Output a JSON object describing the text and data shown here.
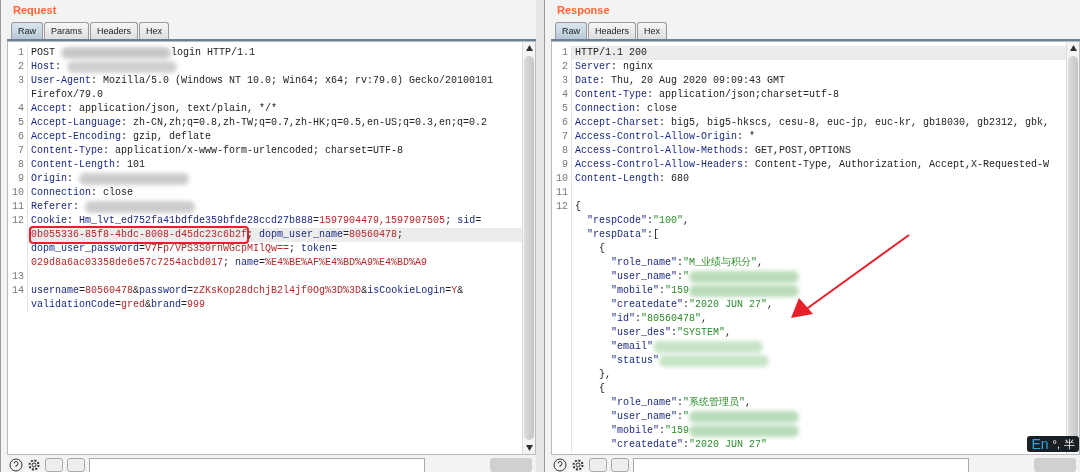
{
  "request": {
    "title": "Request",
    "tabs": [
      {
        "label": "Raw",
        "selected": true
      },
      {
        "label": "Params",
        "selected": false
      },
      {
        "label": "Headers",
        "selected": false
      },
      {
        "label": "Hex",
        "selected": false
      }
    ],
    "lines": [
      {
        "num": "1",
        "selected": false,
        "segments": [
          {
            "kind": "plain",
            "text": "POST "
          },
          {
            "kind": "redacted",
            "color": "#c8c8c8"
          },
          {
            "kind": "plain",
            "text": "login HTTP/1.1"
          }
        ]
      },
      {
        "num": "2",
        "selected": false,
        "segments": [
          {
            "kind": "name",
            "text": "Host"
          },
          {
            "kind": "plain",
            "text": ": "
          },
          {
            "kind": "redacted",
            "color": "#cfcfcf"
          }
        ]
      },
      {
        "num": "3",
        "selected": false,
        "segments": [
          {
            "kind": "name",
            "text": "User-Agent"
          },
          {
            "kind": "plain",
            "text": ": Mozilla/5.0 (Windows NT 10.0; Win64; x64; rv:79.0) Gecko/20100101"
          }
        ]
      },
      {
        "selected": false,
        "segments": [
          {
            "kind": "plain",
            "text": "Firefox/79.0"
          }
        ]
      },
      {
        "num": "4",
        "selected": false,
        "segments": [
          {
            "kind": "name",
            "text": "Accept"
          },
          {
            "kind": "plain",
            "text": ": application/json, text/plain, */*"
          }
        ]
      },
      {
        "num": "5",
        "selected": false,
        "segments": [
          {
            "kind": "name",
            "text": "Accept-Language"
          },
          {
            "kind": "plain",
            "text": ": zh-CN,zh;q=0.8,zh-TW;q=0.7,zh-HK;q=0.5,en-US;q=0.3,en;q=0.2"
          }
        ]
      },
      {
        "num": "6",
        "selected": false,
        "segments": [
          {
            "kind": "name",
            "text": "Accept-Encoding"
          },
          {
            "kind": "plain",
            "text": ": gzip, deflate"
          }
        ]
      },
      {
        "num": "7",
        "selected": false,
        "segments": [
          {
            "kind": "name",
            "text": "Content-Type"
          },
          {
            "kind": "plain",
            "text": ": application/x-www-form-urlencoded; charset=UTF-8"
          }
        ]
      },
      {
        "num": "8",
        "selected": false,
        "segments": [
          {
            "kind": "name",
            "text": "Content-Length"
          },
          {
            "kind": "plain",
            "text": ": 101"
          }
        ]
      },
      {
        "num": "9",
        "selected": false,
        "segments": [
          {
            "kind": "name",
            "text": "Origin"
          },
          {
            "kind": "plain",
            "text": ": "
          },
          {
            "kind": "redacted",
            "color": "#cccccc"
          }
        ]
      },
      {
        "num": "10",
        "selected": false,
        "segments": [
          {
            "kind": "name",
            "text": "Connection"
          },
          {
            "kind": "plain",
            "text": ": close"
          }
        ]
      },
      {
        "num": "11",
        "selected": false,
        "segments": [
          {
            "kind": "name",
            "text": "Referer"
          },
          {
            "kind": "plain",
            "text": ": "
          },
          {
            "kind": "redacted",
            "color": "#cccccc"
          }
        ]
      },
      {
        "num": "12",
        "selected": false,
        "segments": [
          {
            "kind": "name",
            "text": "Cookie"
          },
          {
            "kind": "plain",
            "text": ": "
          },
          {
            "kind": "name",
            "text": "Hm_lvt_ed752fa41bdfde359bfde28ccd27b888"
          },
          {
            "kind": "plain",
            "text": "="
          },
          {
            "kind": "value",
            "text": "1597904479,1597907505"
          },
          {
            "kind": "plain",
            "text": "; "
          },
          {
            "kind": "name",
            "text": "sid"
          },
          {
            "kind": "plain",
            "text": "="
          }
        ]
      },
      {
        "selected": true,
        "segments": [
          {
            "kind": "value",
            "text": "0b055336-85f8-4bdc-8008-d45dc23c6b2f",
            "highlighted": true
          },
          {
            "kind": "plain",
            "text": "; "
          },
          {
            "kind": "name",
            "text": "dopm_user_name"
          },
          {
            "kind": "plain",
            "text": "="
          },
          {
            "kind": "value",
            "text": "80560478"
          },
          {
            "kind": "plain",
            "text": ";"
          }
        ]
      },
      {
        "selected": false,
        "segments": [
          {
            "kind": "name",
            "text": "dopm_user_password"
          },
          {
            "kind": "plain",
            "text": "="
          },
          {
            "kind": "value",
            "text": "V7Fp/VPS3S0rnWGcpMIlQw=="
          },
          {
            "kind": "plain",
            "text": "; "
          },
          {
            "kind": "name",
            "text": "token"
          },
          {
            "kind": "plain",
            "text": "="
          }
        ]
      },
      {
        "selected": false,
        "segments": [
          {
            "kind": "value",
            "text": "029d8a6ac03358de6e57c7254acbd017"
          },
          {
            "kind": "plain",
            "text": "; "
          },
          {
            "kind": "name",
            "text": "name"
          },
          {
            "kind": "plain",
            "text": "="
          },
          {
            "kind": "value",
            "text": "%E4%BE%AF%E4%BD%A9%E4%BD%A9"
          }
        ]
      },
      {
        "num": "13",
        "selected": false
      },
      {
        "num": "14",
        "selected": false,
        "segments": [
          {
            "kind": "name",
            "text": "username"
          },
          {
            "kind": "plain",
            "text": "="
          },
          {
            "kind": "value",
            "text": "80560478"
          },
          {
            "kind": "plain",
            "text": "&"
          },
          {
            "kind": "name",
            "text": "password"
          },
          {
            "kind": "plain",
            "text": "="
          },
          {
            "kind": "value",
            "text": "zZKsKop28dchjB2l4jf0Og%3D%3D"
          },
          {
            "kind": "plain",
            "text": "&"
          },
          {
            "kind": "name",
            "text": "isCookieLogin"
          },
          {
            "kind": "plain",
            "text": "="
          },
          {
            "kind": "value",
            "text": "Y"
          },
          {
            "kind": "plain",
            "text": "&"
          }
        ]
      },
      {
        "selected": false,
        "segments": [
          {
            "kind": "name",
            "text": "validationCode"
          },
          {
            "kind": "plain",
            "text": "="
          },
          {
            "kind": "value",
            "text": "gred"
          },
          {
            "kind": "plain",
            "text": "&"
          },
          {
            "kind": "name",
            "text": "brand"
          },
          {
            "kind": "plain",
            "text": "="
          },
          {
            "kind": "value",
            "text": "999"
          }
        ]
      }
    ]
  },
  "response": {
    "title": "Response",
    "tabs": [
      {
        "label": "Raw",
        "selected": true
      },
      {
        "label": "Headers",
        "selected": false
      },
      {
        "label": "Hex",
        "selected": false
      }
    ],
    "lines": [
      {
        "num": "1",
        "selected": true,
        "segments": [
          {
            "kind": "plain",
            "text": "HTTP/1.1 200"
          }
        ]
      },
      {
        "num": "2",
        "selected": false,
        "segments": [
          {
            "kind": "name",
            "text": "Server"
          },
          {
            "kind": "plain",
            "text": ": nginx"
          }
        ]
      },
      {
        "num": "3",
        "selected": false,
        "segments": [
          {
            "kind": "name",
            "text": "Date"
          },
          {
            "kind": "plain",
            "text": ": Thu, 20 Aug 2020 09:09:43 GMT"
          }
        ]
      },
      {
        "num": "4",
        "selected": false,
        "segments": [
          {
            "kind": "name",
            "text": "Content-Type"
          },
          {
            "kind": "plain",
            "text": ": application/json;charset=utf-8"
          }
        ]
      },
      {
        "num": "5",
        "selected": false,
        "segments": [
          {
            "kind": "name",
            "text": "Connection"
          },
          {
            "kind": "plain",
            "text": ": close"
          }
        ]
      },
      {
        "num": "6",
        "selected": false,
        "segments": [
          {
            "kind": "name",
            "text": "Accept-Charset"
          },
          {
            "kind": "plain",
            "text": ": big5, big5-hkscs, cesu-8, euc-jp, euc-kr, gb18030, gb2312, gbk,"
          }
        ]
      },
      {
        "num": "7",
        "selected": false,
        "segments": [
          {
            "kind": "name",
            "text": "Access-Control-Allow-Origin"
          },
          {
            "kind": "plain",
            "text": ": *"
          }
        ]
      },
      {
        "num": "8",
        "selected": false,
        "segments": [
          {
            "kind": "name",
            "text": "Access-Control-Allow-Methods"
          },
          {
            "kind": "plain",
            "text": ": GET,POST,OPTIONS"
          }
        ]
      },
      {
        "num": "9",
        "selected": false,
        "segments": [
          {
            "kind": "name",
            "text": "Access-Control-Allow-Headers"
          },
          {
            "kind": "plain",
            "text": ": Content-Type, Authorization, Accept,X-Requested-W"
          }
        ]
      },
      {
        "num": "10",
        "selected": false,
        "segments": [
          {
            "kind": "name",
            "text": "Content-Length"
          },
          {
            "kind": "plain",
            "text": ": 680"
          }
        ]
      },
      {
        "num": "11",
        "selected": false
      },
      {
        "num": "12",
        "selected": false,
        "segments": [
          {
            "kind": "plain",
            "text": "{"
          }
        ]
      },
      {
        "selected": false,
        "segments": [
          {
            "kind": "key",
            "text": "  \"respCode\""
          },
          {
            "kind": "plain",
            "text": ":"
          },
          {
            "kind": "string",
            "text": "\"100\""
          },
          {
            "kind": "plain",
            "text": ","
          }
        ]
      },
      {
        "selected": false,
        "segments": [
          {
            "kind": "key",
            "text": "  \"respData\""
          },
          {
            "kind": "plain",
            "text": ":["
          }
        ]
      },
      {
        "selected": false,
        "segments": [
          {
            "kind": "plain",
            "text": "    {"
          }
        ]
      },
      {
        "selected": false,
        "segments": [
          {
            "kind": "key",
            "text": "      \"role_name\""
          },
          {
            "kind": "plain",
            "text": ":"
          },
          {
            "kind": "string",
            "text": "\"M_业绩与积分\""
          },
          {
            "kind": "plain",
            "text": ","
          }
        ]
      },
      {
        "selected": false,
        "segments": [
          {
            "kind": "key",
            "text": "      \"user_name\""
          },
          {
            "kind": "plain",
            "text": ":"
          },
          {
            "kind": "string",
            "text": "\""
          },
          {
            "kind": "redacted",
            "color": "#b9dcb9"
          }
        ]
      },
      {
        "selected": false,
        "segments": [
          {
            "kind": "key",
            "text": "      \"mobile\""
          },
          {
            "kind": "plain",
            "text": ":"
          },
          {
            "kind": "string",
            "text": "\"159"
          },
          {
            "kind": "redacted",
            "color": "#b9dcb9"
          }
        ]
      },
      {
        "selected": false,
        "segments": [
          {
            "kind": "key",
            "text": "      \"createdate\""
          },
          {
            "kind": "plain",
            "text": ":"
          },
          {
            "kind": "string",
            "text": "\"2020 JUN 27\""
          },
          {
            "kind": "plain",
            "text": ","
          }
        ]
      },
      {
        "selected": false,
        "segments": [
          {
            "kind": "key",
            "text": "      \"id\""
          },
          {
            "kind": "plain",
            "text": ":"
          },
          {
            "kind": "string",
            "text": "\"80560478\""
          },
          {
            "kind": "plain",
            "text": ","
          }
        ]
      },
      {
        "selected": false,
        "segments": [
          {
            "kind": "key",
            "text": "      \"user_des\""
          },
          {
            "kind": "plain",
            "text": ":"
          },
          {
            "kind": "string",
            "text": "\"SYSTEM\""
          },
          {
            "kind": "plain",
            "text": ","
          }
        ]
      },
      {
        "selected": false,
        "segments": [
          {
            "kind": "key",
            "text": "      \"email\""
          },
          {
            "kind": "redacted",
            "color": "#c6e4c6"
          }
        ]
      },
      {
        "selected": false,
        "segments": [
          {
            "kind": "key",
            "text": "      \"status\""
          },
          {
            "kind": "redacted",
            "color": "#c6e4c6"
          }
        ]
      },
      {
        "selected": false,
        "segments": [
          {
            "kind": "plain",
            "text": "    },"
          }
        ]
      },
      {
        "selected": false,
        "segments": [
          {
            "kind": "plain",
            "text": "    {"
          }
        ]
      },
      {
        "selected": false,
        "segments": [
          {
            "kind": "key",
            "text": "      \"role_name\""
          },
          {
            "kind": "plain",
            "text": ":"
          },
          {
            "kind": "string",
            "text": "\"系统管理员\""
          },
          {
            "kind": "plain",
            "text": ","
          }
        ]
      },
      {
        "selected": false,
        "segments": [
          {
            "kind": "key",
            "text": "      \"user_name\""
          },
          {
            "kind": "plain",
            "text": ":"
          },
          {
            "kind": "string",
            "text": "\""
          },
          {
            "kind": "redacted",
            "color": "#b9dcb9"
          }
        ]
      },
      {
        "selected": false,
        "segments": [
          {
            "kind": "key",
            "text": "      \"mobile\""
          },
          {
            "kind": "plain",
            "text": ":"
          },
          {
            "kind": "string",
            "text": "\"159"
          },
          {
            "kind": "redacted",
            "color": "#b9dcb9"
          }
        ]
      },
      {
        "selected": false,
        "segments": [
          {
            "kind": "key",
            "text": "      \"createdate\""
          },
          {
            "kind": "plain",
            "text": ":"
          },
          {
            "kind": "string",
            "text": "\"2020 JUN 27\""
          }
        ]
      }
    ],
    "ime": {
      "mode": "En",
      "punct": "°,",
      "width": "半"
    }
  }
}
